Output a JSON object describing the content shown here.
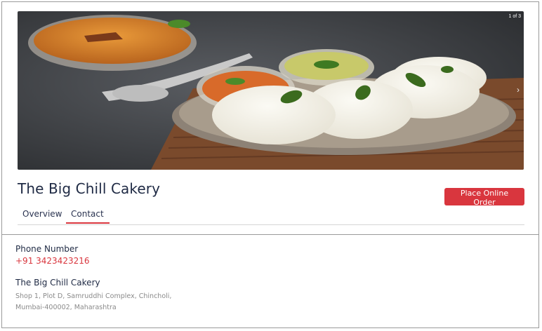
{
  "carousel": {
    "counter": "1 of 3",
    "next_icon": "chevron-right-icon",
    "slide_count": 3,
    "active_slide": 1
  },
  "restaurant": {
    "name": "The Big Chill Cakery"
  },
  "actions": {
    "order_label": "Place Online Order",
    "accent_color": "#d9363e"
  },
  "tabs": [
    {
      "label": "Overview",
      "active": false
    },
    {
      "label": "Contact",
      "active": true
    }
  ],
  "contact": {
    "phone_heading": "Phone Number",
    "phone": "+91 3423423216",
    "address_heading": "The Big Chill Cakery",
    "address_line1": "Shop 1, Plot D, Samruddhi Complex, Chincholi,",
    "address_line2": "Mumbai-400002, Maharashtra"
  }
}
